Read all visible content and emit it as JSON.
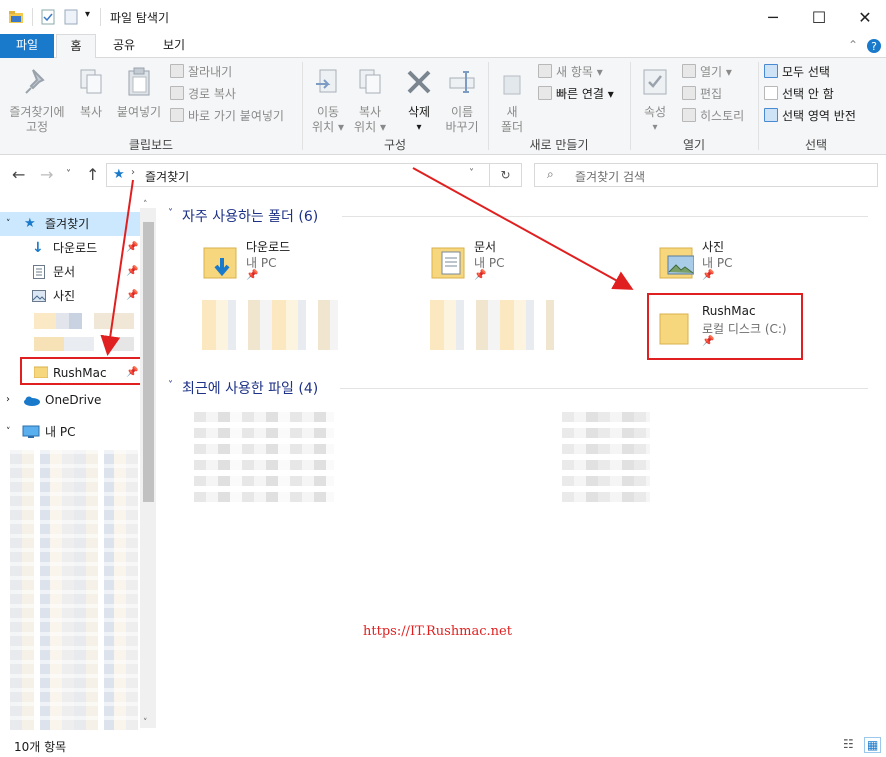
{
  "window": {
    "title": "파일 탐색기",
    "controls": [
      "minimize",
      "maximize",
      "close"
    ]
  },
  "tabs": {
    "file": "파일",
    "home": "홈",
    "share": "공유",
    "view": "보기"
  },
  "ribbon": {
    "clipboard": {
      "pin_quick": "즐겨찾기에\n고정",
      "pin_quick_l1": "즐겨찾기에",
      "pin_quick_l2": "고정",
      "copy": "복사",
      "paste": "붙여넣기",
      "cut": "잘라내기",
      "copy_path": "경로 복사",
      "paste_shortcut": "바로 가기 붙여넣기",
      "label": "클립보드"
    },
    "organize": {
      "move_l1": "이동",
      "move_l2": "위치",
      "copy_l1": "복사",
      "copy_l2": "위치",
      "delete": "삭제",
      "rename_l1": "이름",
      "rename_l2": "바꾸기",
      "label": "구성"
    },
    "new": {
      "new_folder_l1": "새",
      "new_folder_l2": "폴더",
      "new_item": "새 항목",
      "easy_access": "빠른 연결",
      "label": "새로 만들기"
    },
    "open": {
      "properties": "속성",
      "open": "열기",
      "edit": "편집",
      "history": "히스토리",
      "label": "열기"
    },
    "select": {
      "select_all": "모두 선택",
      "select_none": "선택 안 함",
      "invert": "선택 영역 반전",
      "label": "선택"
    }
  },
  "address": {
    "path": "즐겨찾기",
    "search_placeholder": "즐겨찾기 검색"
  },
  "sidebar": {
    "quick_access": "즐겨찾기",
    "items": [
      "다운로드",
      "문서",
      "사진",
      "RushMac"
    ],
    "onedrive": "OneDrive",
    "this_pc": "내 PC"
  },
  "content": {
    "frequent_header": "자주 사용하는 폴더 (6)",
    "recent_header": "최근에 사용한 파일 (4)",
    "folders": [
      {
        "name": "다운로드",
        "location": "내 PC"
      },
      {
        "name": "문서",
        "location": "내 PC"
      },
      {
        "name": "사진",
        "location": "내 PC"
      },
      {
        "name": "RushMac",
        "location": "로컬 디스크 (C:)"
      }
    ]
  },
  "watermark": "https://IT.Rushmac.net",
  "status": {
    "count": "10개 항목"
  },
  "colors": {
    "accent": "#1979ca",
    "highlight_box": "#e02020",
    "selected_bg": "#cce8ff",
    "section_header": "#1e3287"
  }
}
